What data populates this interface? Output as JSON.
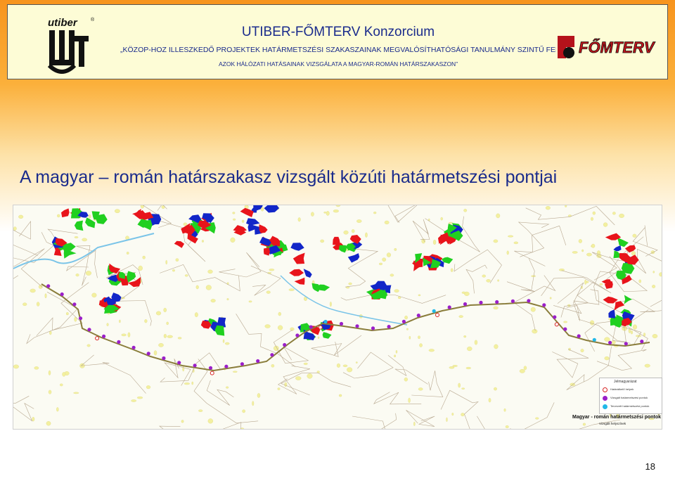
{
  "header": {
    "title": "UTIBER-FŐMTERV Konzorcium",
    "line1": "„KÖZOP-HOZ ILLESZKEDŐ PROJEKTEK HATÁRMETSZÉSI SZAKASZAINAK MEGVALÓSÍTHATÓSÁGI TANULMÁNY  SZINTŰ FELTÁRÁSA ÉS",
    "line2": "AZOK HÁLÓZATI HATÁSAINAK VIZSGÁLATA A MAGYAR-ROMÁN HATÁRSZAKASZON”",
    "left_logo_text": "utiber",
    "right_logo_text": "FŐMTERV"
  },
  "slide": {
    "title": "A magyar – román határszakasz vizsgált közúti határmetszési pontjai",
    "page_number": "18"
  },
  "map": {
    "legend_heading": "Jelmagyarázat",
    "legend_items": [
      {
        "label": "Határátkelő helyek",
        "color": "#d62020",
        "style": "ring"
      },
      {
        "label": "Vizsgált határmetszési pontok",
        "color": "#9b1fc9",
        "style": "dot"
      },
      {
        "label": "Tervezett határmetszési pontok",
        "color": "#22b8e8",
        "style": "dot"
      }
    ],
    "caption_title": "Magyar - román határmetszési pontok",
    "caption_subtitle": "Vizsgált helyszínek",
    "colors": {
      "border": "#9b1fc9",
      "border_line": "#8a7d3b",
      "natura_red": "#e8141b",
      "natura_blue": "#1226c8",
      "natura_green": "#20d020",
      "road": "#b8a890",
      "settlement": "#f3f0a0",
      "water": "#7ac4e8"
    }
  }
}
